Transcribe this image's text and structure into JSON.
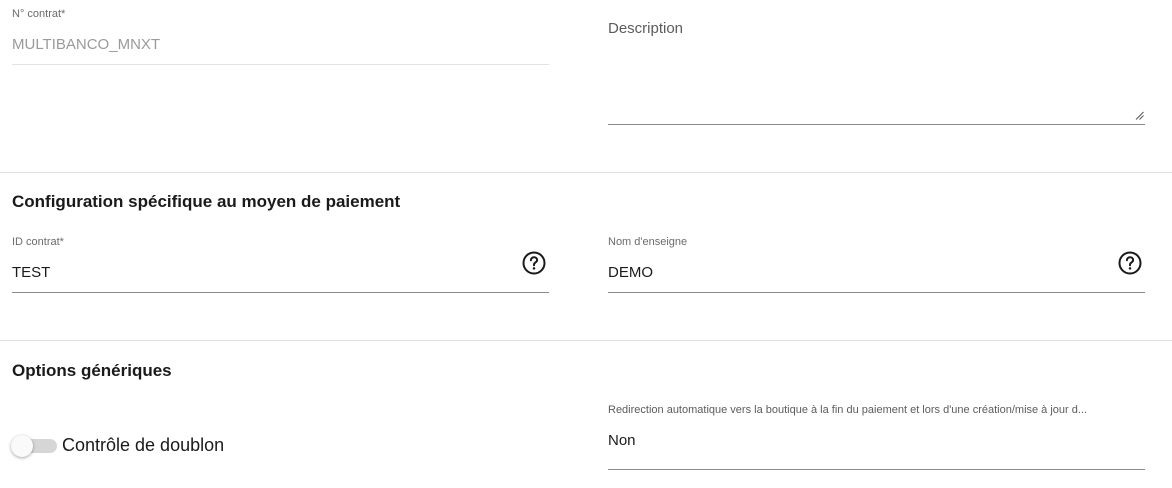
{
  "contract": {
    "label": "N° contrat*",
    "value": "MULTIBANCO_MNXT"
  },
  "description": {
    "label": "Description",
    "value": ""
  },
  "payment_config": {
    "title": "Configuration spécifique au moyen de paiement",
    "contract_id": {
      "label": "ID contrat*",
      "value": "TEST"
    },
    "store_name": {
      "label": "Nom d'enseigne",
      "value": "DEMO"
    }
  },
  "generic_options": {
    "title": "Options génériques",
    "duplicate_control": {
      "label": "Contrôle de doublon",
      "enabled": false
    },
    "redirect": {
      "label": "Redirection automatique vers la boutique à la fin du paiement et lors d'une création/mise à jour d...",
      "value": "Non"
    }
  },
  "icons": {
    "help": "help-circle-icon",
    "resize": "resize-handle-icon"
  }
}
